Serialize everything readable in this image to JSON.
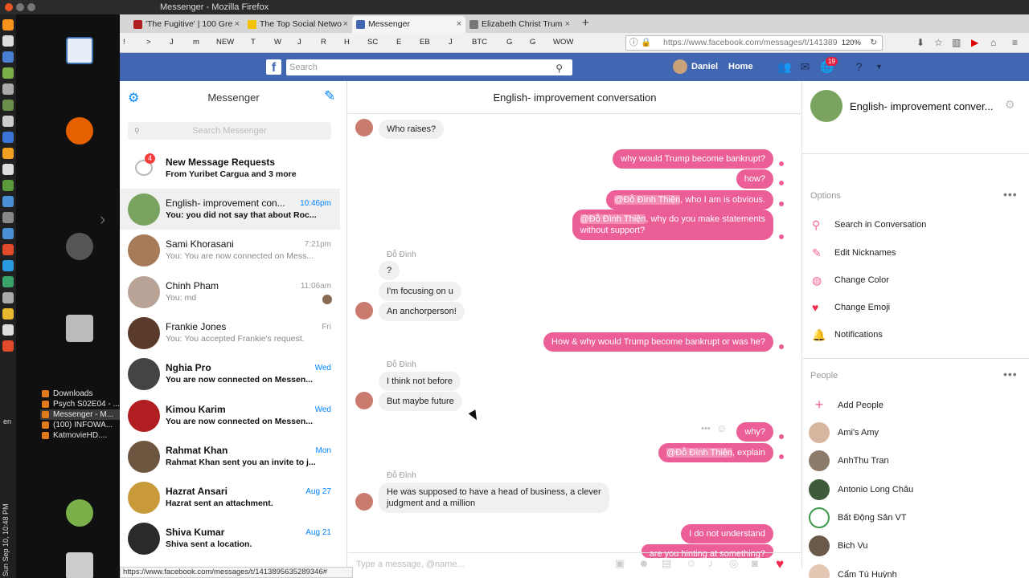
{
  "window": {
    "title": "Messenger - Mozilla Firefox"
  },
  "tabs": [
    {
      "label": "'The Fugitive' | 100 Gre"
    },
    {
      "label": "The Top Social Netwo"
    },
    {
      "label": "Messenger"
    },
    {
      "label": "Elizabeth Christ Trum"
    }
  ],
  "bookmarks": [
    "!",
    ">",
    "J",
    "m",
    "NEW",
    "T",
    "W",
    "J",
    "R",
    "H",
    "SC",
    "E",
    "EB",
    "J",
    "BTC",
    "G",
    "G",
    "WOW"
  ],
  "url": {
    "value": "https://www.facebook.com/messages/t/141389",
    "zoom": "120%"
  },
  "fb": {
    "search_placeholder": "Search",
    "user_name": "Daniel",
    "home_label": "Home",
    "notif_count": "19"
  },
  "messenger": {
    "title": "Messenger",
    "search_placeholder": "Search Messenger",
    "requests": {
      "title": "New Message Requests",
      "subtitle": "From Yuribet Cargua and 3 more",
      "badge": "4"
    },
    "conversations": [
      {
        "name": "English- improvement con...",
        "preview": "You: you did not say that about Roc...",
        "time": "10:46pm",
        "color": "#7aa35f"
      },
      {
        "name": "Sami Khorasani",
        "preview": "You: You are now connected on Mess...",
        "time": "7:21pm",
        "color": "#a57b5a"
      },
      {
        "name": "Chinh Pham",
        "preview": "You: md",
        "time": "11:06am",
        "color": "#b8a396"
      },
      {
        "name": "Frankie Jones",
        "preview": "You: You accepted Frankie's request.",
        "time": "Fri",
        "color": "#5a3a2a"
      },
      {
        "name": "Nghia Pro",
        "preview": "You are now connected on Messen...",
        "time": "Wed",
        "color": "#444444"
      },
      {
        "name": "Kimou Karim",
        "preview": "You are now connected on Messen...",
        "time": "Wed",
        "color": "#b01e22"
      },
      {
        "name": "Rahmat Khan",
        "preview": "Rahmat Khan sent you an invite to j...",
        "time": "Mon",
        "color": "#6d5640"
      },
      {
        "name": "Hazrat Ansari",
        "preview": "Hazrat sent an attachment.",
        "time": "Aug 27",
        "color": "#c89a3a"
      },
      {
        "name": "Shiva Kumar",
        "preview": "Shiva sent a location.",
        "time": "Aug 21",
        "color": "#2a2a2a"
      }
    ]
  },
  "chat": {
    "title": "English- improvement conversation",
    "sender_name": "Đỗ Đình",
    "messages": {
      "m0": "Who raises?",
      "m1": "why would Trump become bankrupt?",
      "m2": "how?",
      "m3_mention": "@Đỗ Đình Thiện",
      "m3_text": ", who I am is obvious.",
      "m4_mention": "@Đỗ Đình Thiện",
      "m4_text": ", why do you make statements",
      "m4_text2": "without support?",
      "m5": "?",
      "m6": "I'm focusing on u",
      "m7": "An anchorperson!",
      "m8": "How & why would Trump become bankrupt or was he?",
      "m9": "I think not before",
      "m10": "But maybe future",
      "m11": "why?",
      "m12_mention": "@Đỗ Đình Thiện",
      "m12_text": ", explain",
      "m13": "He was supposed to have a head of business, a clever",
      "m13b": "judgment and a million",
      "m14": "I do not understand",
      "m15": "are you hinting at something?"
    },
    "compose_placeholder": "Type a message, @name..."
  },
  "details": {
    "title": "English- improvement conver...",
    "options_label": "Options",
    "options": [
      "Search in Conversation",
      "Edit Nicknames",
      "Change Color",
      "Change Emoji",
      "Notifications"
    ],
    "people_label": "People",
    "add_people": "Add People",
    "people": [
      {
        "name": "Ami's Amy",
        "color": "#d7b6a0"
      },
      {
        "name": "AnhThu Tran",
        "color": "#8c7a6a"
      },
      {
        "name": "Antonio Long Châu",
        "color": "#3f5a3a"
      },
      {
        "name": "Bất Động Sản VT",
        "color": "#ffffff"
      },
      {
        "name": "Bich Vu",
        "color": "#6b5a4a"
      },
      {
        "name": "Cẩm Tú Huỳnh",
        "color": "#e3c7b3"
      }
    ]
  },
  "desktop": {
    "items": [
      "Downloads",
      "Psych S02E04 - ...",
      "Messenger - M...",
      "(100) INFOWA...",
      "KatmovieHD...."
    ],
    "clock": "Sun Sep 10, 10:48 PM",
    "lang": "en"
  },
  "statusbar": "https://www.facebook.com/messages/t/1413895635289346#"
}
